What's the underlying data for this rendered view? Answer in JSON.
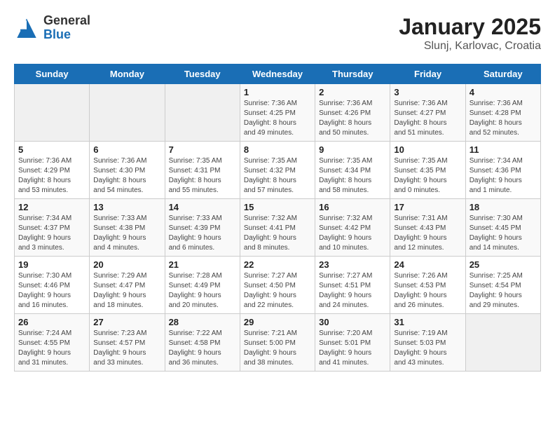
{
  "header": {
    "logo_general": "General",
    "logo_blue": "Blue",
    "month_title": "January 2025",
    "subtitle": "Slunj, Karlovac, Croatia"
  },
  "weekdays": [
    "Sunday",
    "Monday",
    "Tuesday",
    "Wednesday",
    "Thursday",
    "Friday",
    "Saturday"
  ],
  "weeks": [
    [
      {
        "day": "",
        "detail": ""
      },
      {
        "day": "",
        "detail": ""
      },
      {
        "day": "",
        "detail": ""
      },
      {
        "day": "1",
        "detail": "Sunrise: 7:36 AM\nSunset: 4:25 PM\nDaylight: 8 hours\nand 49 minutes."
      },
      {
        "day": "2",
        "detail": "Sunrise: 7:36 AM\nSunset: 4:26 PM\nDaylight: 8 hours\nand 50 minutes."
      },
      {
        "day": "3",
        "detail": "Sunrise: 7:36 AM\nSunset: 4:27 PM\nDaylight: 8 hours\nand 51 minutes."
      },
      {
        "day": "4",
        "detail": "Sunrise: 7:36 AM\nSunset: 4:28 PM\nDaylight: 8 hours\nand 52 minutes."
      }
    ],
    [
      {
        "day": "5",
        "detail": "Sunrise: 7:36 AM\nSunset: 4:29 PM\nDaylight: 8 hours\nand 53 minutes."
      },
      {
        "day": "6",
        "detail": "Sunrise: 7:36 AM\nSunset: 4:30 PM\nDaylight: 8 hours\nand 54 minutes."
      },
      {
        "day": "7",
        "detail": "Sunrise: 7:35 AM\nSunset: 4:31 PM\nDaylight: 8 hours\nand 55 minutes."
      },
      {
        "day": "8",
        "detail": "Sunrise: 7:35 AM\nSunset: 4:32 PM\nDaylight: 8 hours\nand 57 minutes."
      },
      {
        "day": "9",
        "detail": "Sunrise: 7:35 AM\nSunset: 4:34 PM\nDaylight: 8 hours\nand 58 minutes."
      },
      {
        "day": "10",
        "detail": "Sunrise: 7:35 AM\nSunset: 4:35 PM\nDaylight: 9 hours\nand 0 minutes."
      },
      {
        "day": "11",
        "detail": "Sunrise: 7:34 AM\nSunset: 4:36 PM\nDaylight: 9 hours\nand 1 minute."
      }
    ],
    [
      {
        "day": "12",
        "detail": "Sunrise: 7:34 AM\nSunset: 4:37 PM\nDaylight: 9 hours\nand 3 minutes."
      },
      {
        "day": "13",
        "detail": "Sunrise: 7:33 AM\nSunset: 4:38 PM\nDaylight: 9 hours\nand 4 minutes."
      },
      {
        "day": "14",
        "detail": "Sunrise: 7:33 AM\nSunset: 4:39 PM\nDaylight: 9 hours\nand 6 minutes."
      },
      {
        "day": "15",
        "detail": "Sunrise: 7:32 AM\nSunset: 4:41 PM\nDaylight: 9 hours\nand 8 minutes."
      },
      {
        "day": "16",
        "detail": "Sunrise: 7:32 AM\nSunset: 4:42 PM\nDaylight: 9 hours\nand 10 minutes."
      },
      {
        "day": "17",
        "detail": "Sunrise: 7:31 AM\nSunset: 4:43 PM\nDaylight: 9 hours\nand 12 minutes."
      },
      {
        "day": "18",
        "detail": "Sunrise: 7:30 AM\nSunset: 4:45 PM\nDaylight: 9 hours\nand 14 minutes."
      }
    ],
    [
      {
        "day": "19",
        "detail": "Sunrise: 7:30 AM\nSunset: 4:46 PM\nDaylight: 9 hours\nand 16 minutes."
      },
      {
        "day": "20",
        "detail": "Sunrise: 7:29 AM\nSunset: 4:47 PM\nDaylight: 9 hours\nand 18 minutes."
      },
      {
        "day": "21",
        "detail": "Sunrise: 7:28 AM\nSunset: 4:49 PM\nDaylight: 9 hours\nand 20 minutes."
      },
      {
        "day": "22",
        "detail": "Sunrise: 7:27 AM\nSunset: 4:50 PM\nDaylight: 9 hours\nand 22 minutes."
      },
      {
        "day": "23",
        "detail": "Sunrise: 7:27 AM\nSunset: 4:51 PM\nDaylight: 9 hours\nand 24 minutes."
      },
      {
        "day": "24",
        "detail": "Sunrise: 7:26 AM\nSunset: 4:53 PM\nDaylight: 9 hours\nand 26 minutes."
      },
      {
        "day": "25",
        "detail": "Sunrise: 7:25 AM\nSunset: 4:54 PM\nDaylight: 9 hours\nand 29 minutes."
      }
    ],
    [
      {
        "day": "26",
        "detail": "Sunrise: 7:24 AM\nSunset: 4:55 PM\nDaylight: 9 hours\nand 31 minutes."
      },
      {
        "day": "27",
        "detail": "Sunrise: 7:23 AM\nSunset: 4:57 PM\nDaylight: 9 hours\nand 33 minutes."
      },
      {
        "day": "28",
        "detail": "Sunrise: 7:22 AM\nSunset: 4:58 PM\nDaylight: 9 hours\nand 36 minutes."
      },
      {
        "day": "29",
        "detail": "Sunrise: 7:21 AM\nSunset: 5:00 PM\nDaylight: 9 hours\nand 38 minutes."
      },
      {
        "day": "30",
        "detail": "Sunrise: 7:20 AM\nSunset: 5:01 PM\nDaylight: 9 hours\nand 41 minutes."
      },
      {
        "day": "31",
        "detail": "Sunrise: 7:19 AM\nSunset: 5:03 PM\nDaylight: 9 hours\nand 43 minutes."
      },
      {
        "day": "",
        "detail": ""
      }
    ]
  ]
}
